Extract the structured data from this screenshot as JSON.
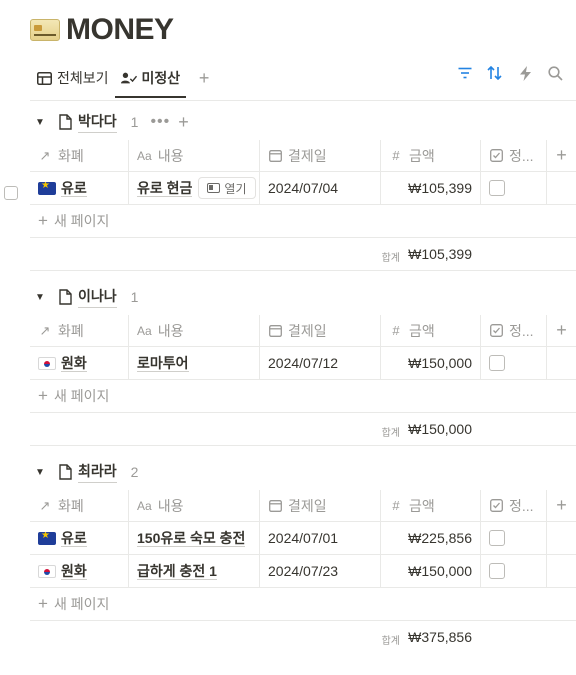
{
  "page": {
    "title": "MONEY"
  },
  "tabs": [
    {
      "label": "전체보기"
    },
    {
      "label": "미정산"
    }
  ],
  "columns": {
    "currency": "화폐",
    "content": "내용",
    "content_prefix": "Aa",
    "date": "결제일",
    "amount": "금액",
    "settled": "정..."
  },
  "open_button_label": "열기",
  "new_page_label": "새 페이지",
  "sum_label": "합계",
  "groups": [
    {
      "name": "박다다",
      "count": "1",
      "rows": [
        {
          "currency": "유로",
          "flag": "eu",
          "content": "유로 현금",
          "date": "2024/07/04",
          "amount": "₩105,399"
        }
      ],
      "sum": "₩105,399"
    },
    {
      "name": "이나나",
      "count": "1",
      "rows": [
        {
          "currency": "원화",
          "flag": "kr",
          "content": "로마투어",
          "date": "2024/07/12",
          "amount": "₩150,000"
        }
      ],
      "sum": "₩150,000"
    },
    {
      "name": "최라라",
      "count": "2",
      "rows": [
        {
          "currency": "유로",
          "flag": "eu",
          "content": "150유로 숙모 충전",
          "date": "2024/07/01",
          "amount": "₩225,856"
        },
        {
          "currency": "원화",
          "flag": "kr",
          "content": "급하게 충전 1",
          "date": "2024/07/23",
          "amount": "₩150,000"
        }
      ],
      "sum": "₩375,856"
    }
  ],
  "colors": {
    "accent": "#2383e2",
    "text": "#37352f",
    "muted": "#9b9a97",
    "border": "#e9e9e7"
  }
}
